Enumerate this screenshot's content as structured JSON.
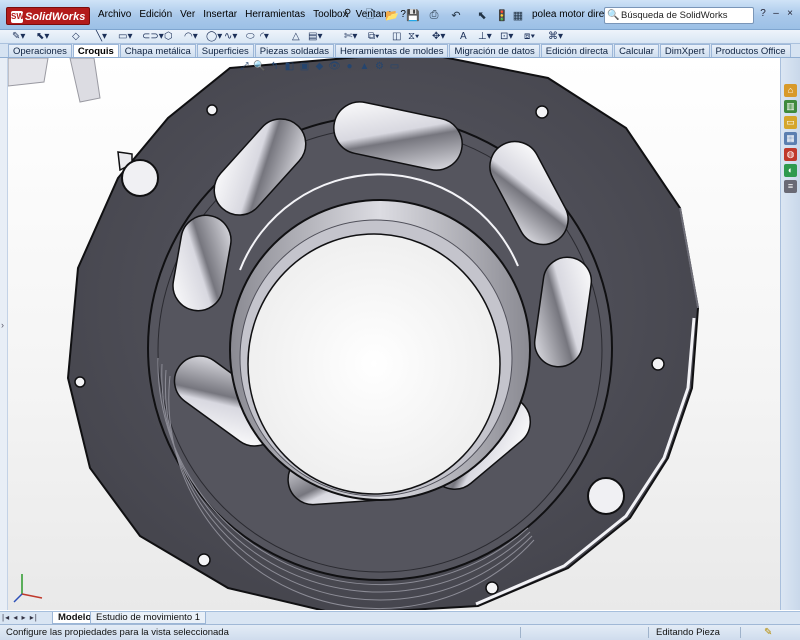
{
  "app": {
    "logo_text": "SolidWorks",
    "logo_badge": "SW",
    "menu": [
      "Archivo",
      "Edición",
      "Ver",
      "Insertar",
      "Herramientas",
      "Toolbox",
      "Ventana",
      "?"
    ],
    "document_title": "polea motor direct...",
    "search_placeholder": "Búsqueda de SolidWorks"
  },
  "tabs": [
    {
      "label": "Operaciones",
      "active": false
    },
    {
      "label": "Croquis",
      "active": true
    },
    {
      "label": "Chapa metálica",
      "active": false
    },
    {
      "label": "Superficies",
      "active": false
    },
    {
      "label": "Piezas soldadas",
      "active": false
    },
    {
      "label": "Herramientas de moldes",
      "active": false
    },
    {
      "label": "Migración de datos",
      "active": false
    },
    {
      "label": "Edición directa",
      "active": false
    },
    {
      "label": "Calcular",
      "active": false
    },
    {
      "label": "DimXpert",
      "active": false
    },
    {
      "label": "Productos Office",
      "active": false
    }
  ],
  "bottom_tabs": [
    {
      "label": "Modelo",
      "active": true
    },
    {
      "label": "Estudio de movimiento 1",
      "active": false
    }
  ],
  "status": {
    "message": "Configure las propiedades para la vista seleccionada",
    "mode": "Editando Pieza"
  },
  "colors": {
    "part_face": "#4e4e57",
    "part_edge": "#101012",
    "highlight": "#f2f2f6",
    "title_bar": "#a9c8ea",
    "logo": "#b31b1b"
  },
  "icons": {
    "task_pane": [
      "home-icon",
      "library-icon",
      "folder-icon",
      "view-palette-icon",
      "appearances-icon",
      "custom-properties-icon",
      "toolbox-icon"
    ]
  }
}
